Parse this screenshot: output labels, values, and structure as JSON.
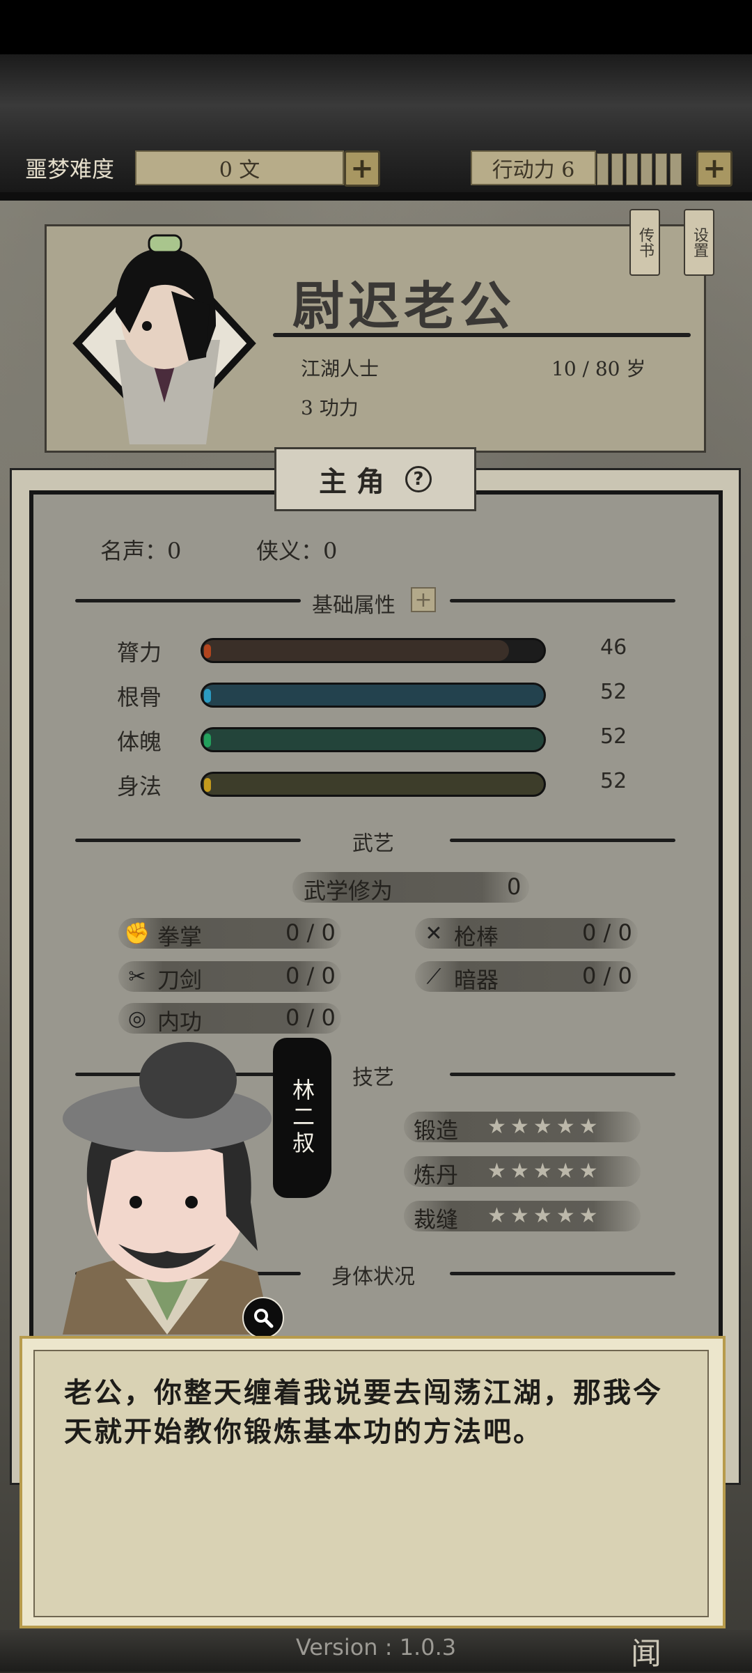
{
  "resources": {
    "difficulty_label": "噩梦难度",
    "difficulty_value": "0 文",
    "action_label": "行动力 6"
  },
  "profile": {
    "name": "尉迟老公",
    "identity": "江湖人士",
    "age": "10 / 80 岁",
    "kungfu": "3 功力",
    "btn_letters": "传书",
    "btn_settings": "设置"
  },
  "tab": {
    "label": "主 角",
    "help": "?"
  },
  "reputation": {
    "fame": "名声：0",
    "chivalry": "侠义：0"
  },
  "sections": {
    "basic": "基础属性",
    "martial": "武艺",
    "crafts": "技艺",
    "body": "身体状况"
  },
  "attributes": [
    {
      "label": "膂力",
      "value": "46",
      "ratio": 0.46,
      "color": "#3a2f28",
      "cap": "#b2451e"
    },
    {
      "label": "根骨",
      "value": "52",
      "ratio": 0.52,
      "color": "#23424e",
      "cap": "#2b9bc2"
    },
    {
      "label": "体魄",
      "value": "52",
      "ratio": 0.52,
      "color": "#23443a",
      "cap": "#23a05c"
    },
    {
      "label": "身法",
      "value": "52",
      "ratio": 0.52,
      "color": "#3d3d2a",
      "cap": "#c49a1d"
    }
  ],
  "martial": {
    "cultivation_label": "武学修为",
    "cultivation_value": "0",
    "skills": [
      {
        "label": "拳掌",
        "value": "0 / 0",
        "icon": "fist-icon"
      },
      {
        "label": "枪棒",
        "value": "0 / 0",
        "icon": "spear-icon"
      },
      {
        "label": "刀剑",
        "value": "0 / 0",
        "icon": "sword-icon"
      },
      {
        "label": "暗器",
        "value": "0 / 0",
        "icon": "dart-icon"
      },
      {
        "label": "内功",
        "value": "0 / 0",
        "icon": "inner-energy-icon"
      }
    ]
  },
  "crafts": [
    {
      "label": "锻造",
      "stars": 0,
      "max": 5
    },
    {
      "label": "炼丹",
      "stars": 0,
      "max": 5
    },
    {
      "label": "裁缝",
      "stars": 0,
      "max": 5
    }
  ],
  "npc": {
    "name": "林二叔"
  },
  "dialog": {
    "text": "老公，你整天缠着我说要去闯荡江湖，那我今天就开始教你锻炼基本功的方法吧。"
  },
  "version": "Version : 1.0.3",
  "bottom_glyph": "闻"
}
